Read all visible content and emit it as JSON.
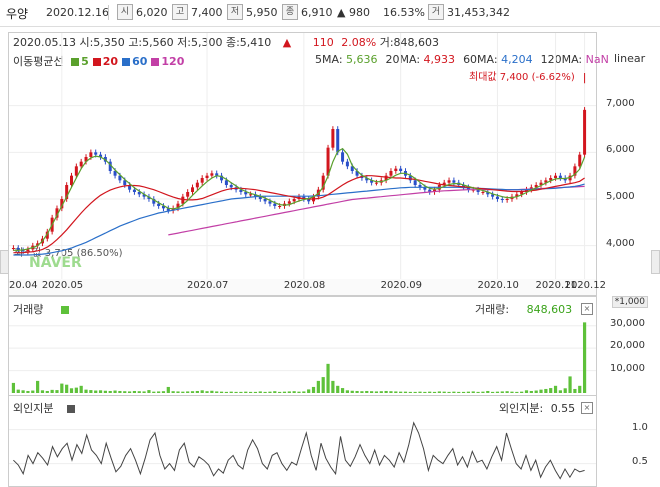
{
  "header": {
    "stock_name": "우양",
    "date": "2020.12.16",
    "open_label": "시",
    "open_value": "6,020",
    "high_label": "고",
    "high_value": "7,400",
    "low_label": "저",
    "low_value": "5,950",
    "close_label": "종",
    "close_value": "6,910",
    "change_value": "▲ 980",
    "change_pct": "16.53%",
    "volume_label": "거",
    "volume_value": "31,453,342"
  },
  "info_bar": {
    "date": "2020.05.13",
    "open": "시:5,350",
    "high": "고:5,560",
    "low": "저:5,300",
    "close": "종:5,410",
    "arrow": "▲",
    "change": "110",
    "change_pct": "2.08%",
    "volume": "거:848,603"
  },
  "ma_legend": {
    "title": "이동평균선",
    "items": [
      {
        "label": "5",
        "color": "#5aa02c"
      },
      {
        "label": "20",
        "color": "#d2161e"
      },
      {
        "label": "60",
        "color": "#2a6fc9"
      },
      {
        "label": "120",
        "color": "#c23fa6"
      }
    ],
    "values_text": [
      {
        "label": "5MA:",
        "value": "5,636",
        "color": "#5aa02c"
      },
      {
        "label": "20MA:",
        "value": "4,933",
        "color": "#d2161e"
      },
      {
        "label": "60MA:",
        "value": "4,204",
        "color": "#2a6fc9"
      },
      {
        "label": "120MA:",
        "value": "NaN",
        "color": "#c23fa6"
      }
    ]
  },
  "scale_label": "linear",
  "max_annotation": "최대값 7,400 (-6.62%)",
  "min_annotation": "최소값 3,705 (86.50%)",
  "watermark": "NAVER",
  "x_axis_labels": [
    "20.04",
    "2020.05",
    "2020.07",
    "2020.08",
    "2020.09",
    "2020.10",
    "2020.11",
    "2020.12"
  ],
  "price_axis": [
    "7,000",
    "6,000",
    "5,000",
    "4,000"
  ],
  "volume_panel": {
    "title": "거래량",
    "legend_label": "거래량:",
    "legend_value": "848,603",
    "unit": "*1,000",
    "axis": [
      "30,000",
      "20,000",
      "10,000"
    ],
    "color": "#5ec13a"
  },
  "foreign_panel": {
    "title": "외인지분",
    "legend_label": "외인지분:",
    "legend_value": "0.55",
    "axis": [
      "1.0",
      "0.5"
    ]
  },
  "chart_data": {
    "type": "candlestick",
    "price_range": [
      3500,
      7700
    ],
    "close_series": [
      3950,
      3900,
      3880,
      3920,
      4000,
      4050,
      4150,
      4300,
      4600,
      4800,
      5000,
      5300,
      5500,
      5700,
      5800,
      5900,
      6000,
      5950,
      5900,
      5800,
      5600,
      5500,
      5400,
      5300,
      5200,
      5150,
      5100,
      5050,
      5000,
      4900,
      4850,
      4800,
      4750,
      4800,
      4900,
      5050,
      5150,
      5250,
      5350,
      5450,
      5500,
      5550,
      5500,
      5400,
      5300,
      5250,
      5200,
      5150,
      5100,
      5100,
      5050,
      5000,
      4950,
      4900,
      4850,
      4850,
      4900,
      4950,
      5000,
      5050,
      5000,
      4950,
      5050,
      5200,
      5500,
      6100,
      6500,
      6000,
      5800,
      5700,
      5600,
      5500,
      5450,
      5400,
      5350,
      5350,
      5400,
      5500,
      5600,
      5650,
      5600,
      5500,
      5400,
      5300,
      5250,
      5200,
      5150,
      5200,
      5300,
      5350,
      5400,
      5350,
      5300,
      5250,
      5200,
      5200,
      5150,
      5150,
      5100,
      5050,
      5000,
      4980,
      5000,
      5050,
      5100,
      5150,
      5200,
      5250,
      5300,
      5350,
      5400,
      5450,
      5500,
      5450,
      5400,
      5500,
      5700,
      5950,
      6910
    ],
    "ma5": [
      3900,
      3900,
      3910,
      3930,
      3960,
      4000,
      4100,
      4250,
      4450,
      4650,
      4850,
      5050,
      5250,
      5450,
      5650,
      5800,
      5880,
      5920,
      5900,
      5840,
      5740,
      5620,
      5520,
      5420,
      5330,
      5240,
      5170,
      5100,
      5040,
      4980,
      4920,
      4860,
      4800,
      4790,
      4810,
      4880,
      4970,
      5080,
      5180,
      5280,
      5370,
      5450,
      5500,
      5480,
      5420,
      5350,
      5280,
      5210,
      5160,
      5120,
      5090,
      5060,
      5020,
      4970,
      4920,
      4880,
      4870,
      4880,
      4920,
      4960,
      4990,
      5010,
      5050,
      5120,
      5260,
      5490,
      5800,
      6020,
      6080,
      5960,
      5720,
      5600,
      5510,
      5450,
      5400,
      5370,
      5370,
      5400,
      5450,
      5510,
      5550,
      5550,
      5510,
      5440,
      5360,
      5280,
      5230,
      5210,
      5230,
      5270,
      5310,
      5330,
      5330,
      5300,
      5270,
      5240,
      5210,
      5180,
      5150,
      5110,
      5080,
      5050,
      5030,
      5030,
      5050,
      5090,
      5140,
      5190,
      5240,
      5290,
      5340,
      5390,
      5430,
      5440,
      5440,
      5460,
      5530,
      5640,
      5900
    ],
    "ma20": [
      3850,
      3850,
      3850,
      3860,
      3870,
      3890,
      3920,
      3970,
      4040,
      4130,
      4230,
      4340,
      4460,
      4580,
      4700,
      4810,
      4910,
      5000,
      5080,
      5140,
      5190,
      5230,
      5260,
      5280,
      5290,
      5290,
      5280,
      5260,
      5230,
      5200,
      5160,
      5120,
      5080,
      5040,
      5010,
      4990,
      4980,
      4980,
      4990,
      5010,
      5050,
      5090,
      5130,
      5170,
      5200,
      5220,
      5230,
      5230,
      5220,
      5210,
      5200,
      5180,
      5160,
      5140,
      5120,
      5100,
      5080,
      5060,
      5040,
      5020,
      5010,
      5000,
      5000,
      5010,
      5040,
      5090,
      5160,
      5230,
      5300,
      5360,
      5410,
      5450,
      5480,
      5500,
      5500,
      5490,
      5480,
      5470,
      5460,
      5450,
      5450,
      5440,
      5430,
      5420,
      5400,
      5380,
      5360,
      5340,
      5320,
      5300,
      5290,
      5280,
      5270,
      5260,
      5250,
      5240,
      5230,
      5220,
      5210,
      5200,
      5190,
      5180,
      5170,
      5160,
      5160,
      5160,
      5170,
      5180,
      5190,
      5210,
      5230,
      5250,
      5270,
      5290,
      5310,
      5330,
      5350,
      5380,
      5450
    ],
    "ma60": [
      3800,
      3800,
      3800,
      3800,
      3805,
      3810,
      3820,
      3830,
      3850,
      3870,
      3890,
      3920,
      3950,
      3990,
      4030,
      4070,
      4120,
      4170,
      4220,
      4270,
      4320,
      4370,
      4420,
      4460,
      4500,
      4540,
      4580,
      4610,
      4640,
      4670,
      4700,
      4720,
      4740,
      4760,
      4780,
      4800,
      4820,
      4840,
      4860,
      4880,
      4900,
      4920,
      4940,
      4960,
      4980,
      5000,
      5010,
      5020,
      5030,
      5040,
      5050,
      5055,
      5060,
      5060,
      5060,
      5060,
      5060,
      5060,
      5060,
      5060,
      5060,
      5060,
      5065,
      5070,
      5080,
      5090,
      5100,
      5110,
      5120,
      5130,
      5140,
      5150,
      5160,
      5170,
      5180,
      5190,
      5200,
      5210,
      5220,
      5230,
      5240,
      5245,
      5250,
      5250,
      5250,
      5250,
      5250,
      5250,
      5250,
      5250,
      5250,
      5250,
      5250,
      5245,
      5240,
      5235,
      5230,
      5225,
      5220,
      5215,
      5210,
      5205,
      5200,
      5200,
      5200,
      5200,
      5200,
      5205,
      5210,
      5215,
      5220,
      5225,
      5230,
      5240,
      5250,
      5260,
      5270,
      5290,
      5320
    ],
    "ma120": [
      null,
      null,
      null,
      null,
      null,
      null,
      null,
      null,
      null,
      null,
      null,
      null,
      null,
      null,
      null,
      null,
      null,
      null,
      null,
      null,
      null,
      null,
      null,
      null,
      null,
      null,
      null,
      null,
      null,
      null,
      null,
      null,
      4230,
      4250,
      4270,
      4290,
      4310,
      4330,
      4350,
      4370,
      4390,
      4410,
      4430,
      4450,
      4470,
      4490,
      4510,
      4530,
      4550,
      4570,
      4590,
      4610,
      4630,
      4650,
      4670,
      4690,
      4710,
      4730,
      4750,
      4770,
      4790,
      4810,
      4830,
      4850,
      4870,
      4890,
      4910,
      4930,
      4950,
      4970,
      4990,
      5000,
      5010,
      5020,
      5030,
      5040,
      5050,
      5060,
      5070,
      5080,
      5090,
      5100,
      5110,
      5120,
      5130,
      5140,
      5150,
      5160,
      5170,
      5175,
      5180,
      5185,
      5190,
      5195,
      5200,
      5200,
      5200,
      5200,
      5200,
      5200,
      5200,
      5200,
      5200,
      5200,
      5200,
      5205,
      5210,
      5215,
      5220,
      5225,
      5230,
      5235,
      5240,
      5245,
      5250,
      5255,
      5260,
      5265,
      5270
    ],
    "volume_range": [
      0,
      33000
    ],
    "volume": [
      4500,
      1500,
      1200,
      900,
      1100,
      5400,
      1200,
      900,
      1400,
      1300,
      4200,
      3700,
      2100,
      2400,
      3200,
      1500,
      1300,
      1100,
      1200,
      1000,
      900,
      1100,
      900,
      800,
      700,
      900,
      800,
      700,
      1300,
      600,
      700,
      800,
      2700,
      800,
      700,
      600,
      700,
      800,
      900,
      1200,
      800,
      1000,
      700,
      600,
      500,
      600,
      500,
      500,
      600,
      500,
      500,
      700,
      500,
      600,
      800,
      500,
      600,
      700,
      800,
      600,
      700,
      1600,
      2700,
      5400,
      7100,
      13000,
      5400,
      3200,
      2200,
      1200,
      1000,
      900,
      800,
      900,
      800,
      700,
      800,
      900,
      800,
      700,
      600,
      600,
      500,
      500,
      600,
      500,
      600,
      500,
      700,
      600,
      500,
      600,
      500,
      500,
      600,
      700,
      500,
      600,
      900,
      500,
      600,
      700,
      800,
      600,
      500,
      600,
      1200,
      900,
      1100,
      1500,
      1800,
      2200,
      3200,
      1200,
      2100,
      7400,
      1800,
      3200,
      31500
    ],
    "foreign_range": [
      0.2,
      1.2
    ],
    "foreign": [
      0.55,
      0.48,
      0.35,
      0.62,
      0.5,
      0.66,
      0.58,
      0.48,
      0.75,
      0.6,
      0.72,
      0.8,
      0.55,
      0.78,
      0.65,
      0.92,
      0.7,
      0.62,
      0.5,
      0.8,
      0.58,
      0.38,
      0.46,
      0.62,
      0.72,
      0.55,
      0.35,
      0.58,
      0.85,
      0.95,
      0.62,
      0.42,
      0.5,
      0.4,
      0.7,
      0.8,
      0.52,
      0.45,
      0.6,
      0.55,
      0.48,
      0.32,
      0.42,
      0.36,
      0.55,
      0.62,
      0.48,
      0.42,
      0.7,
      0.85,
      0.72,
      0.5,
      0.42,
      0.62,
      0.66,
      0.5,
      0.4,
      0.52,
      0.48,
      0.72,
      0.95,
      0.62,
      0.4,
      0.8,
      0.58,
      0.45,
      0.35,
      0.9,
      0.55,
      0.46,
      0.6,
      0.78,
      0.62,
      0.5,
      0.7,
      0.48,
      0.62,
      0.55,
      0.45,
      0.66,
      0.52,
      0.78,
      1.1,
      0.95,
      0.72,
      0.4,
      0.62,
      0.55,
      0.5,
      0.62,
      0.72,
      0.48,
      0.6,
      0.45,
      0.68,
      0.52,
      0.55,
      0.42,
      0.6,
      0.75,
      0.55,
      0.95,
      0.72,
      0.5,
      0.42,
      0.62,
      0.4,
      0.55,
      0.3,
      0.45,
      0.55,
      0.4,
      0.28,
      0.42,
      0.3,
      0.42,
      0.38,
      0.4
    ]
  }
}
